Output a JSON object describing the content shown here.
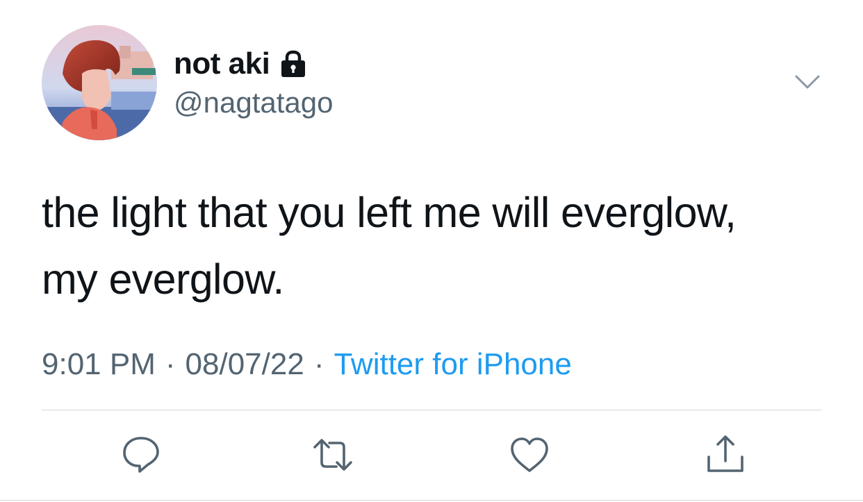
{
  "user": {
    "display_name": "not aki",
    "handle": "@nagtatago",
    "protected_icon": "lock-icon",
    "avatar": "profile-photo"
  },
  "tweet": {
    "text_line1": "the light that you left me will everglow,",
    "text_line2": "my everglow."
  },
  "meta": {
    "time": "9:01 PM",
    "separator": "·",
    "date": "08/07/22",
    "source": "Twitter for iPhone"
  },
  "actions": [
    {
      "icon": "reply-icon"
    },
    {
      "icon": "retweet-icon"
    },
    {
      "icon": "like-icon"
    },
    {
      "icon": "share-icon"
    }
  ],
  "colors": {
    "text": "#0f1419",
    "secondary": "#536471",
    "link": "#1d9bf0",
    "divider": "#cfd9de"
  }
}
